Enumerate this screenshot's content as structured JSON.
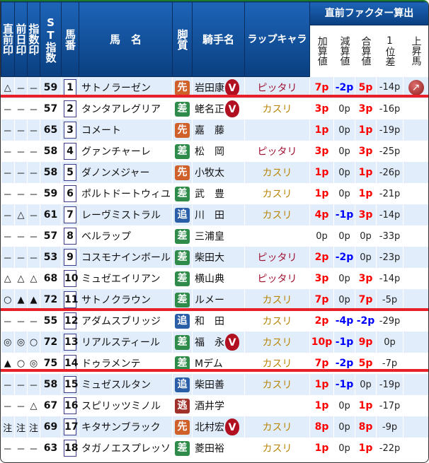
{
  "header": {
    "c1": "直前印",
    "c2": "前日印",
    "c3": "指数印",
    "st": "ST指数",
    "num": "馬番",
    "name": "馬　名",
    "leg": "脚質",
    "jockey": "騎手名",
    "lap": "ラップキャラ",
    "factor": "直前ファクター算出",
    "f1": "加算値",
    "f2": "減算値",
    "f3": "合算値",
    "f4": "1位差",
    "f5": "上昇馬"
  },
  "colors": {
    "pos": "#ff0000",
    "neg": "#0000ff",
    "pitari": "#a01030",
    "kasuri": "#b8860b",
    "red_line": "#e8202a"
  },
  "leg_colors": {
    "先": "#d0602a",
    "差": "#2e8b4a",
    "追": "#2a5fa8",
    "逃": "#a0302a"
  },
  "rows": [
    {
      "m1": "△",
      "m2": "－",
      "m3": "－",
      "st": "59",
      "num": "1",
      "name": "サトノラーゼン",
      "leg": "先",
      "jockey": "岩田康",
      "v": true,
      "lap": "ピッタリ",
      "a": "7p",
      "b": "-2p",
      "c": "5p",
      "d": "-14p",
      "up": true
    },
    {
      "m1": "－",
      "m2": "－",
      "m3": "－",
      "st": "57",
      "num": "2",
      "name": "タンタアレグリア",
      "leg": "差",
      "jockey": "蛯名正",
      "v": true,
      "lap": "カスリ",
      "a": "3p",
      "b": "0p",
      "c": "3p",
      "d": "-16p"
    },
    {
      "m1": "－",
      "m2": "－",
      "m3": "－",
      "st": "65",
      "num": "3",
      "name": "コメート",
      "leg": "先",
      "jockey": "嘉　藤",
      "lap": "",
      "a": "1p",
      "b": "0p",
      "c": "1p",
      "d": "-19p"
    },
    {
      "m1": "－",
      "m2": "－",
      "m3": "－",
      "st": "58",
      "num": "4",
      "name": "グァンチャーレ",
      "leg": "差",
      "jockey": "松　岡",
      "lap": "ピッタリ",
      "a": "3p",
      "b": "0p",
      "c": "3p",
      "d": "-25p"
    },
    {
      "m1": "－",
      "m2": "－",
      "m3": "－",
      "st": "58",
      "num": "5",
      "name": "ダノンメジャー",
      "leg": "先",
      "jockey": "小牧太",
      "lap": "カスリ",
      "a": "1p",
      "b": "0p",
      "c": "1p",
      "d": "-26p"
    },
    {
      "m1": "－",
      "m2": "－",
      "m3": "－",
      "st": "59",
      "num": "6",
      "name": "ポルトドートウィユ",
      "leg": "差",
      "jockey": "武　豊",
      "lap": "カスリ",
      "a": "1p",
      "b": "0p",
      "c": "1p",
      "d": "-21p"
    },
    {
      "m1": "－",
      "m2": "△",
      "m3": "－",
      "st": "61",
      "num": "7",
      "name": "レーヴミストラル",
      "leg": "追",
      "jockey": "川　田",
      "lap": "カスリ",
      "a": "4p",
      "b": "-1p",
      "c": "3p",
      "d": "-14p"
    },
    {
      "m1": "－",
      "m2": "－",
      "m3": "－",
      "st": "57",
      "num": "8",
      "name": "ベルラップ",
      "leg": "差",
      "jockey": "三浦皇",
      "lap": "",
      "a": "0p",
      "b": "0p",
      "c": "0p",
      "d": "-33p"
    },
    {
      "m1": "－",
      "m2": "－",
      "m3": "－",
      "st": "53",
      "num": "9",
      "name": "コスモナインボール",
      "leg": "差",
      "jockey": "柴田大",
      "lap": "ピッタリ",
      "a": "2p",
      "b": "-2p",
      "c": "0p",
      "d": "-23p"
    },
    {
      "m1": "△",
      "m2": "△",
      "m3": "△",
      "st": "68",
      "num": "10",
      "name": "ミュゼエイリアン",
      "leg": "差",
      "jockey": "横山典",
      "lap": "ピッタリ",
      "a": "3p",
      "b": "0p",
      "c": "3p",
      "d": "-14p"
    },
    {
      "m1": "○",
      "m2": "▲",
      "m3": "▲",
      "st": "72",
      "num": "11",
      "name": "サトノクラウン",
      "leg": "差",
      "jockey": "ルメー",
      "lap": "カスリ",
      "a": "7p",
      "b": "0p",
      "c": "7p",
      "d": "-5p"
    },
    {
      "m1": "－",
      "m2": "－",
      "m3": "－",
      "st": "55",
      "num": "12",
      "name": "アダムスブリッジ",
      "leg": "追",
      "jockey": "和　田",
      "lap": "カスリ",
      "a": "2p",
      "b": "-4p",
      "c": "-2p",
      "d": "-29p"
    },
    {
      "m1": "◎",
      "m2": "◎",
      "m3": "○",
      "st": "72",
      "num": "13",
      "name": "リアルスティール",
      "leg": "差",
      "jockey": "福　永",
      "v": true,
      "lap": "カスリ",
      "a": "10p",
      "b": "-1p",
      "c": "9p",
      "d": "0p"
    },
    {
      "m1": "▲",
      "m2": "○",
      "m3": "◎",
      "st": "75",
      "num": "14",
      "name": "ドゥラメンテ",
      "leg": "差",
      "jockey": "Mデム",
      "lap": "カスリ",
      "a": "7p",
      "b": "-2p",
      "c": "5p",
      "d": "-7p"
    },
    {
      "m1": "－",
      "m2": "－",
      "m3": "－",
      "st": "58",
      "num": "15",
      "name": "ミュゼスルタン",
      "leg": "追",
      "jockey": "柴田善",
      "lap": "カスリ",
      "a": "1p",
      "b": "-1p",
      "c": "0p",
      "d": "-19p"
    },
    {
      "m1": "－",
      "m2": "－",
      "m3": "△",
      "st": "67",
      "num": "16",
      "name": "スピリッツミノル",
      "leg": "逃",
      "jockey": "酒井学",
      "lap": "",
      "a": "1p",
      "b": "0p",
      "c": "1p",
      "d": "-17p"
    },
    {
      "m1": "注",
      "m2": "注",
      "m3": "注",
      "st": "69",
      "num": "17",
      "name": "キタサンブラック",
      "leg": "先",
      "jockey": "北村宏",
      "v": true,
      "lap": "カスリ",
      "a": "8p",
      "b": "0p",
      "c": "8p",
      "d": "-9p"
    },
    {
      "m1": "－",
      "m2": "－",
      "m3": "－",
      "st": "63",
      "num": "18",
      "name": "タガノエスプレッソ",
      "leg": "差",
      "jockey": "菱田裕",
      "lap": "カスリ",
      "a": "1p",
      "b": "0p",
      "c": "1p",
      "d": "-22p"
    }
  ],
  "icons": {
    "v": "V",
    "up": "↗"
  }
}
